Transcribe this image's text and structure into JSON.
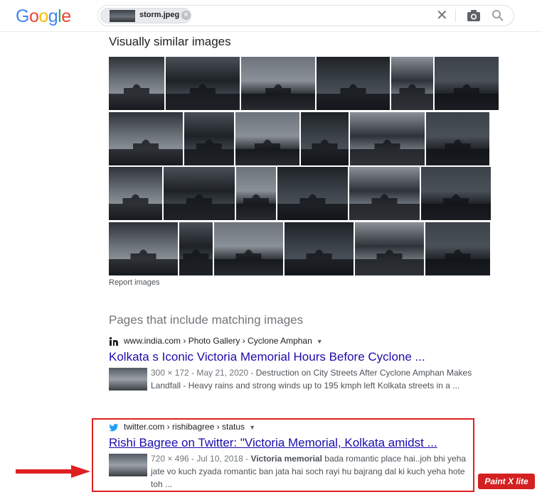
{
  "header": {
    "logo_letters": [
      "G",
      "o",
      "o",
      "g",
      "l",
      "e"
    ],
    "logo_colors": [
      "#4285F4",
      "#EA4335",
      "#FBBC05",
      "#4285F4",
      "#34A853",
      "#EA4335"
    ],
    "search_chip_label": "storm.jpeg",
    "chip_close_glyph": "✕",
    "clear_glyph": "✕",
    "icons": [
      "camera-icon",
      "search-icon"
    ]
  },
  "similar": {
    "title": "Visually similar images",
    "report_link": "Report images",
    "tile_palette": [
      "#2e3339",
      "#4a5058",
      "#6c737a",
      "#1e2226",
      "#8a9097",
      "#3b4249"
    ]
  },
  "pages": {
    "title": "Pages that include matching images",
    "results": [
      {
        "favicon": "in",
        "cite": "www.india.com › Photo Gallery › Cyclone Amphan",
        "title": "Kolkata s Iconic Victoria Memorial Hours Before Cyclone ...",
        "meta": "300 × 172 - May 21, 2020 - ",
        "snippet": "Destruction on City Streets After Cyclone Amphan Makes Landfall - Heavy rains and strong winds up to 195 kmph left Kolkata streets in a ..."
      },
      {
        "favicon": "twitter-bird",
        "cite": "twitter.com › rishibagree › status",
        "title": "Rishi Bagree on Twitter: \"Victoria Memorial, Kolkata amidst ...",
        "meta": "720 × 496 - Jul 10, 2018 - ",
        "snippet_bold": "Victoria memorial",
        "snippet": " bada romantic place hai..joh bhi yeha jate vo kuch zyada romantic ban jata hai soch rayi hu bajrang dal ki kuch yeha hote toh ..."
      }
    ]
  },
  "overlay": {
    "badge_label": "Paint X lite",
    "highlight_color": "#e02020"
  }
}
